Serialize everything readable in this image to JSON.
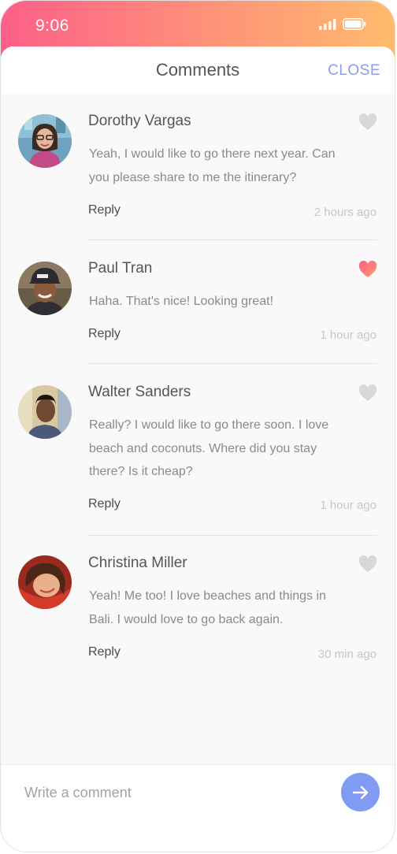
{
  "status_bar": {
    "time": "9:06"
  },
  "header": {
    "title": "Comments",
    "close_label": "CLOSE"
  },
  "comments": [
    {
      "author": "Dorothy Vargas",
      "text": "Yeah, I would like to go there next year. Can you please share to me the itinerary?",
      "time": "2 hours ago",
      "reply_label": "Reply",
      "liked": false
    },
    {
      "author": "Paul Tran",
      "text": "Haha. That's nice! Looking great!",
      "time": "1 hour ago",
      "reply_label": "Reply",
      "liked": true
    },
    {
      "author": "Walter Sanders",
      "text": "Really? I would like to go there soon. I love beach and coconuts. Where did you stay there? Is it cheap?",
      "time": "1 hour ago",
      "reply_label": "Reply",
      "liked": false
    },
    {
      "author": "Christina Miller",
      "text": "Yeah! Me too! I love beaches and things in Bali. I would love to go back again.",
      "time": "30 min ago",
      "reply_label": "Reply",
      "liked": false
    }
  ],
  "composer": {
    "placeholder": "Write a comment",
    "send_icon": "arrow-right-icon"
  },
  "colors": {
    "accent": "#8c9ee8",
    "send_button": "#7f9bf4",
    "heart_liked": "#fb6d77",
    "heart_unliked": "#d8d8d8",
    "gradient_start": "#fd5f88",
    "gradient_end": "#ffbb6d"
  }
}
